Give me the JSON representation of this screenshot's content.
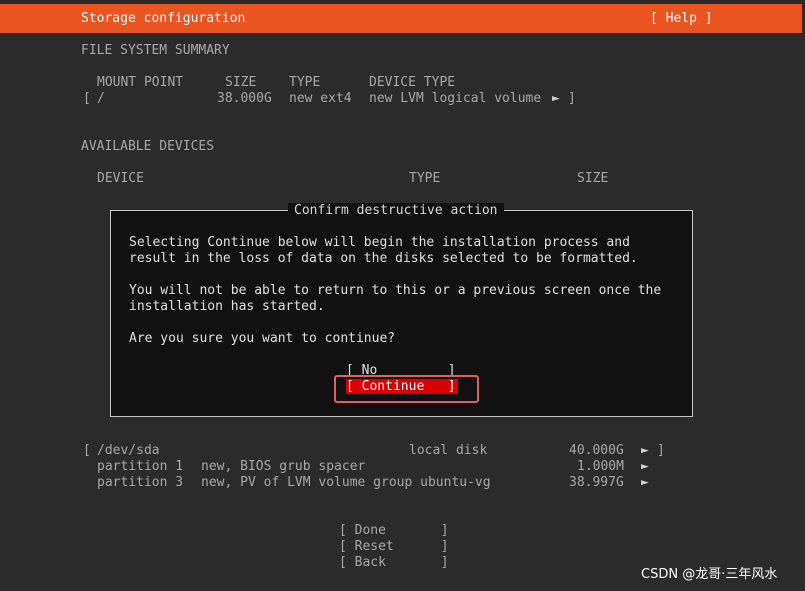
{
  "header": {
    "title": "Storage configuration",
    "help_label": "[ Help ]",
    "color": "#e95420"
  },
  "fs_summary": {
    "heading": "FILE SYSTEM SUMMARY",
    "columns": [
      "MOUNT POINT",
      "SIZE",
      "TYPE",
      "DEVICE TYPE"
    ],
    "row": {
      "open_bracket": "[",
      "mount": "/",
      "size": "38.000G",
      "type": "new ext4",
      "device_type": "new LVM logical volume",
      "arrow": "►",
      "close_bracket": "]"
    }
  },
  "available": {
    "heading": "AVAILABLE DEVICES",
    "columns": [
      "DEVICE",
      "TYPE",
      "SIZE"
    ]
  },
  "dialog": {
    "title": "Confirm destructive action",
    "line1": "Selecting Continue below will begin the installation process and",
    "line2": "result in the loss of data on the disks selected to be formatted.",
    "line3": "You will not be able to return to this or a previous screen once the",
    "line4": "installation has started.",
    "question": "Are you sure you want to continue?",
    "no_label": "[ No         ]",
    "continue_label": "[ Continue   ]"
  },
  "devices": {
    "disk": {
      "open_bracket": "[",
      "name": "/dev/sda",
      "type": "local disk",
      "size": "40.000G",
      "arrow": "►",
      "close_bracket": "]"
    },
    "partitions": [
      {
        "name": "partition 1",
        "desc": "new, BIOS grub spacer",
        "size": "1.000M",
        "arrow": "►"
      },
      {
        "name": "partition 3",
        "desc": "new, PV of LVM volume group ubuntu-vg",
        "size": "38.997G",
        "arrow": "►"
      }
    ]
  },
  "actions": {
    "done": "[ Done       ]",
    "reset": "[ Reset      ]",
    "back": "[ Back       ]"
  },
  "watermark": "CSDN @龙哥·三年风水"
}
